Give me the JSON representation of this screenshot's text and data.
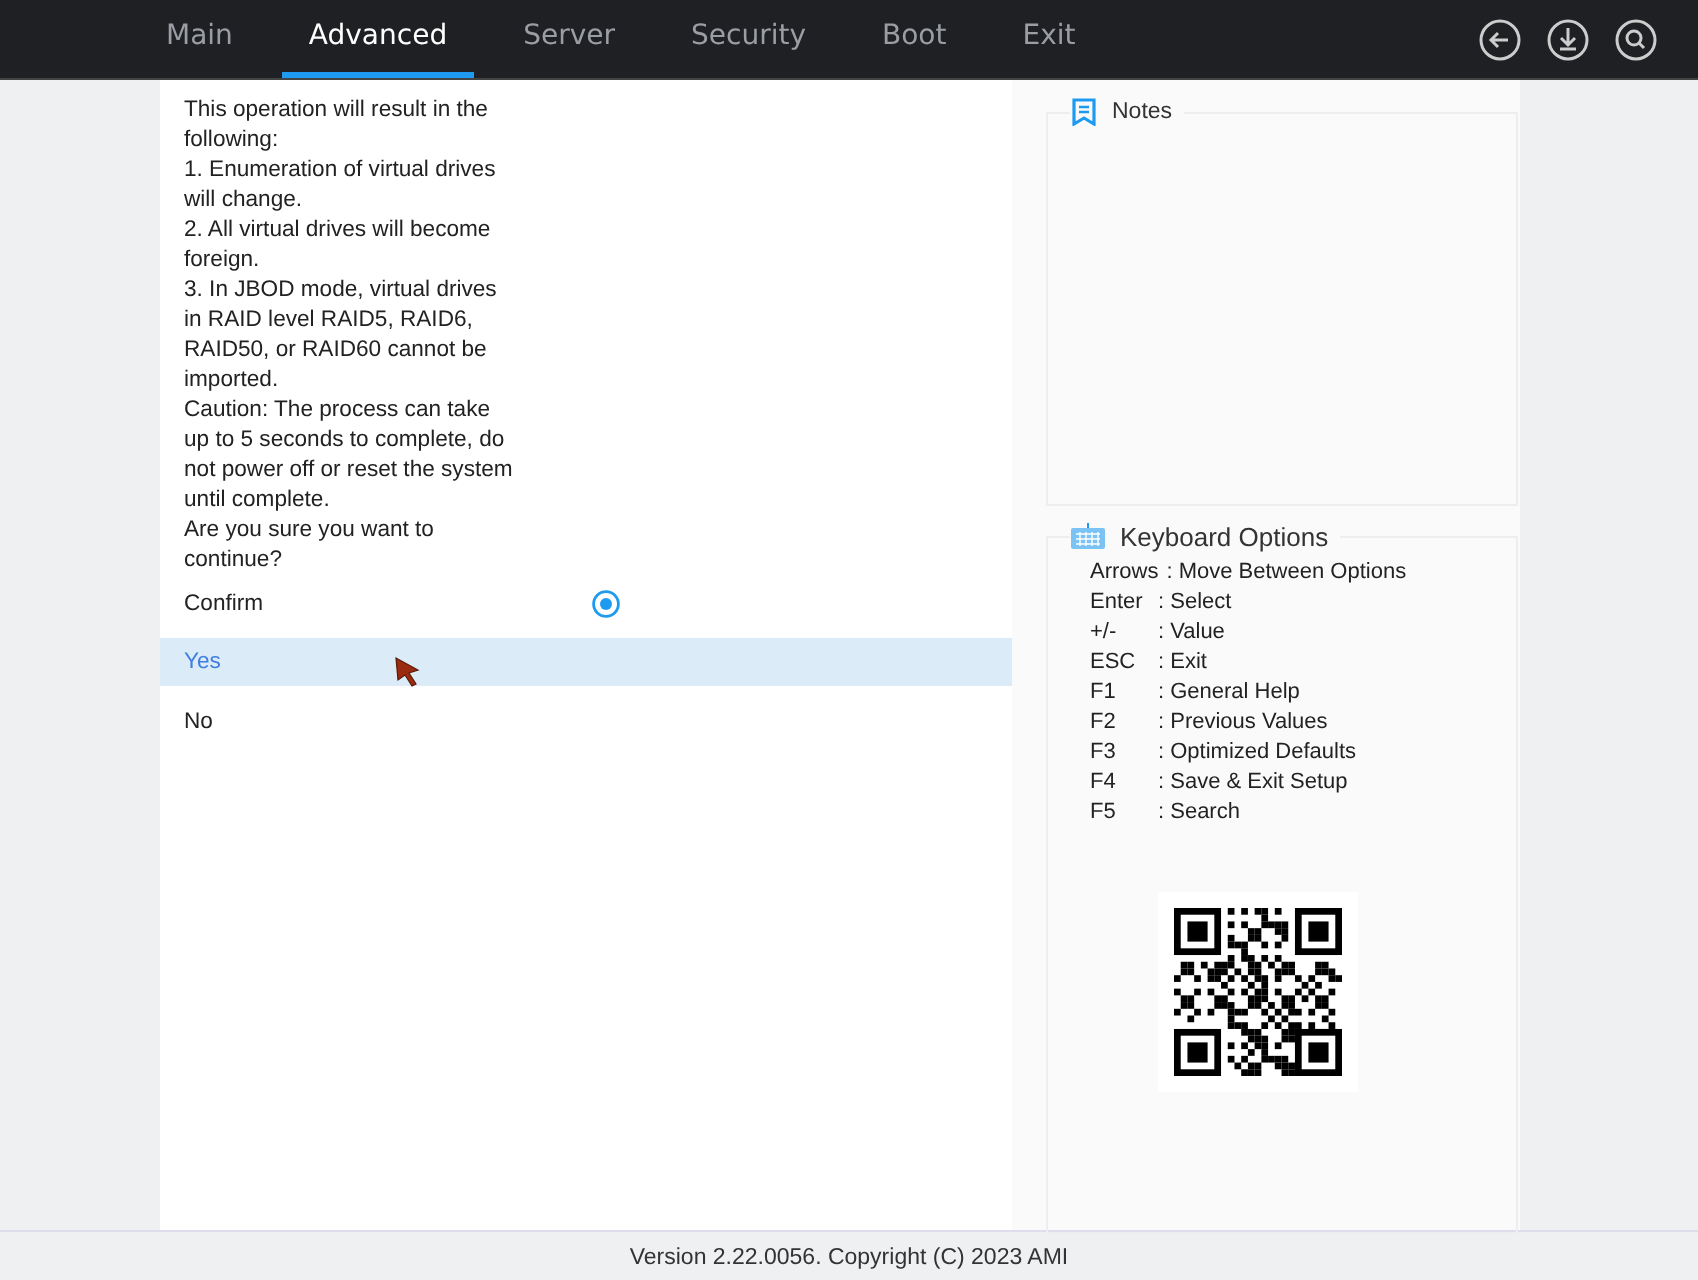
{
  "tabs": [
    {
      "label": "Main",
      "selected": false
    },
    {
      "label": "Advanced",
      "selected": true
    },
    {
      "label": "Server",
      "selected": false
    },
    {
      "label": "Security",
      "selected": false
    },
    {
      "label": "Boot",
      "selected": false
    },
    {
      "label": "Exit",
      "selected": false
    }
  ],
  "message": [
    "This operation will result in the following:",
    "1. Enumeration of virtual drives will change.",
    "2. All virtual drives will become foreign.",
    "3. In JBOD mode, virtual drives in RAID level RAID5, RAID6, RAID50, or RAID60 cannot be imported.",
    "Caution: The process can take up to 5 seconds to complete, do not power off or reset the system until complete.",
    "Are you sure you want to continue?"
  ],
  "setting": {
    "label": "Confirm",
    "checked": true
  },
  "options": [
    {
      "label": "Yes",
      "selected": true
    },
    {
      "label": "No",
      "selected": false
    }
  ],
  "notes": {
    "title": "Notes"
  },
  "keyboard": {
    "title": "Keyboard Options",
    "keys": [
      {
        "key": "Arrows",
        "action": ": Move Between Options"
      },
      {
        "key": "Enter",
        "action": ": Select"
      },
      {
        "key": "+/-",
        "action": ": Value"
      },
      {
        "key": "ESC",
        "action": ": Exit"
      },
      {
        "key": "F1",
        "action": ": General Help"
      },
      {
        "key": "F2",
        "action": ": Previous Values"
      },
      {
        "key": "F3",
        "action": ": Optimized Defaults"
      },
      {
        "key": "F4",
        "action": ": Save & Exit Setup"
      },
      {
        "key": "F5",
        "action": ": Search"
      }
    ]
  },
  "footer": "Version 2.22.0056. Copyright (C) 2023 AMI"
}
